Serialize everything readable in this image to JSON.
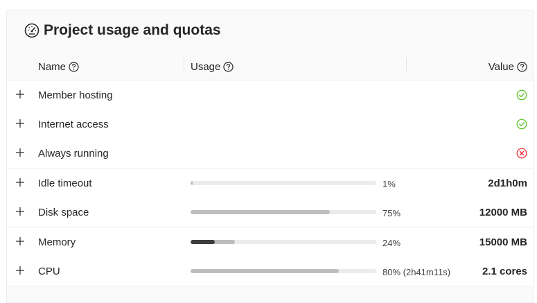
{
  "colors": {
    "ok": "#52c41a",
    "error": "#f5222d",
    "bar_track": "#ebebeb",
    "bar_fill": "#bdbdbd",
    "bar_fill_dark": "#3d3d3d"
  },
  "header": {
    "icon": "dashboard-icon",
    "title": "Project usage and quotas"
  },
  "table": {
    "columns": [
      {
        "label": "Name",
        "help_icon": "question-circle-icon"
      },
      {
        "label": "Usage",
        "help_icon": "question-circle-icon"
      },
      {
        "label": "Value",
        "help_icon": "question-circle-icon"
      }
    ],
    "rows": [
      {
        "name": "Member hosting",
        "status": "ok",
        "status_icon": "check-circle-icon"
      },
      {
        "name": "Internet access",
        "status": "ok",
        "status_icon": "check-circle-icon"
      },
      {
        "name": "Always running",
        "status": "error",
        "status_icon": "close-circle-icon"
      },
      {
        "name": "Idle timeout",
        "usage_label": "1%",
        "usage_fraction": 0.01,
        "value": "2d1h0m"
      },
      {
        "name": "Disk space",
        "usage_label": "75%",
        "usage_fraction": 0.75,
        "value": "12000 MB"
      },
      {
        "name": "Memory",
        "usage_label": "24%",
        "usage_fraction": 0.24,
        "usage_dark_fraction": 0.13,
        "value": "15000 MB"
      },
      {
        "name": "CPU",
        "usage_label": "80% (2h41m11s)",
        "usage_fraction": 0.8,
        "value": "2.1 cores"
      }
    ]
  }
}
